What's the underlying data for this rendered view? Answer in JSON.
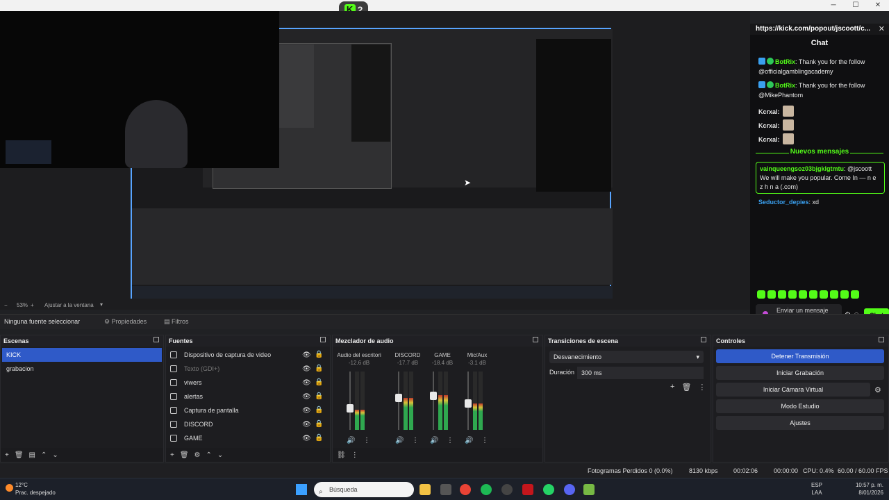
{
  "topbar": {
    "kick_badge_count": "2"
  },
  "preview": {
    "zoom": "53%",
    "fit_label": "Ajustar a la ventana",
    "chat_inner_text": "Thank you for the follow"
  },
  "chat": {
    "url": "https://kick.com/popout/jscoott/c...",
    "title": "Chat",
    "messages": [
      {
        "user": "BotRix",
        "text": ": Thank you for the follow @officialgamblingacademy"
      },
      {
        "user": "BotRix",
        "text": ": Thank you for the follow @MikePhantom"
      }
    ],
    "kcrxal": [
      "Kcrxal:",
      "Kcrxal:",
      "Kcrxal:"
    ],
    "new_messages_label": "Nuevos mensajes",
    "highlight_user": "vainqueengsoz03bjgklgtmtu",
    "highlight_text": ": @jscoott We will make you popular. Come In — n e z h n a (.com)",
    "seductor_user": "Seductor_depies",
    "seductor_text": ": xd",
    "send_placeholder": "Enviar un mensaje",
    "chat_button": "Chat"
  },
  "source_toolbar": {
    "none_selected": "Ninguna fuente seleccionar",
    "properties": "Propiedades",
    "filters": "Filtros"
  },
  "scenes": {
    "title": "Escenas",
    "items": [
      "KICK",
      "grabacion"
    ]
  },
  "sources": {
    "title": "Fuentes",
    "items": [
      "Dispositivo de captura de video",
      "Texto (GDI+)",
      "viwers",
      "alertas",
      "Captura de pantalla",
      "DISCORD",
      "GAME"
    ]
  },
  "mixer": {
    "title": "Mezclador de audio",
    "channels": [
      {
        "name": "Audio del escritori",
        "db": "-12.6 dB",
        "level": 0.35
      },
      {
        "name": "DISCORD",
        "db": "-17.7 dB",
        "level": 0.55
      },
      {
        "name": "GAME",
        "db": "-18.4 dB",
        "level": 0.6
      },
      {
        "name": "Mic/Aux",
        "db": "-3.1 dB",
        "level": 0.45
      }
    ]
  },
  "transitions": {
    "title": "Transiciones de escena",
    "selected": "Desvanecimiento",
    "duration_label": "Duración",
    "duration_value": "300 ms"
  },
  "controls": {
    "title": "Controles",
    "buttons": [
      "Detener Transmisión",
      "Iniciar Grabación",
      "Iniciar Cámara Virtual",
      "Modo Estudio",
      "Ajustes"
    ]
  },
  "status": {
    "dropped": "Fotogramas Perdidos 0 (0.0%)",
    "kbps": "8130 kbps",
    "stream_time": "00:02:06",
    "rec_time": "00:00:00",
    "cpu": "CPU: 0.4%",
    "fps": "60.00 / 60.00 FPS"
  },
  "taskbar": {
    "temp": "12°C",
    "weather": "Prac. despejado",
    "search": "Búsqueda",
    "lang1": "ESP",
    "lang2": "LAA",
    "time": "10:57 p. m.",
    "date": "8/01/2026"
  },
  "colors": {
    "kick_green": "#53fc18",
    "obs_blue": "#2f5ac8",
    "link_blue": "#3aa0f0"
  }
}
